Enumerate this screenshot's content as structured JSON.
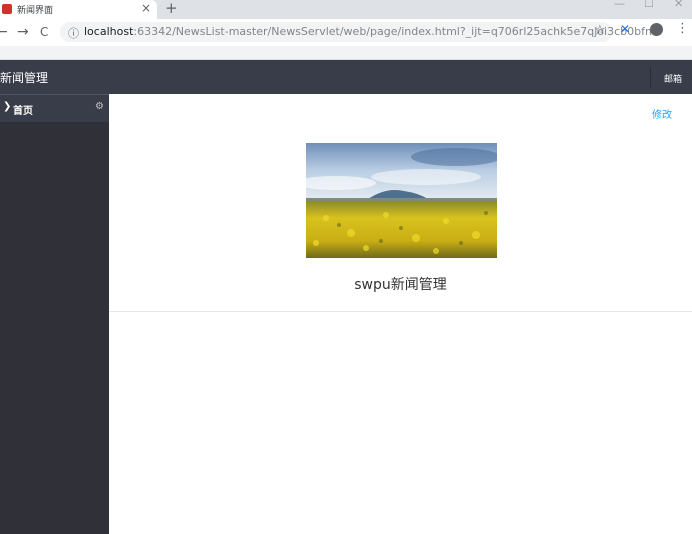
{
  "browser": {
    "tab_title": "新闻界面",
    "tab_close": "×",
    "new_tab": "+",
    "window_controls": [
      "—",
      "☐",
      "✕"
    ],
    "url_host": "localhost",
    "url_rest": ":63342/NewsList-master/NewsServlet/web/page/index.html?_ijt=q706rl25achk5e7qjoi3cb0bfm",
    "nav": {
      "back": "←",
      "forward": "→",
      "reload": "C"
    },
    "icons": {
      "info": "ⓘ",
      "star": "☆",
      "extension": "✕",
      "menu": "⋮"
    }
  },
  "header": {
    "title": "新闻管理",
    "mail_link": "邮箱"
  },
  "sidebar": {
    "items": [
      {
        "label": "首页",
        "chevron": "❯",
        "settings_icon": "⚙"
      }
    ]
  },
  "main": {
    "edit_link": "修改",
    "caption": "swpu新闻管理"
  },
  "colors": {
    "header_bg": "#393d49",
    "sidebar_bg": "#2f3038",
    "link": "#1e9fff"
  }
}
